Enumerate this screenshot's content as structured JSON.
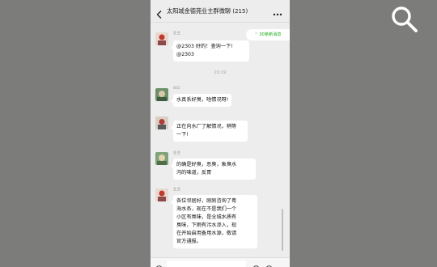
{
  "chat": {
    "title": "太阳城金德苑业主群微聊",
    "member_count": "(215)",
    "unread_notice": "30条新消息",
    "time_separator": "20:19"
  },
  "messages": [
    {
      "sender": "业主",
      "lines": [
        "@2303 好的！查询一下!",
        "@2303"
      ]
    },
    {
      "sender": "802",
      "lines": [
        "水真系好臭，啥情况呀!"
      ]
    },
    {
      "sender": "",
      "lines": [
        "正在向水厂了解情况，稍等",
        "一下!"
      ]
    },
    {
      "sender": "业主",
      "lines": [
        "的确是好臭，恶臭，象臭水",
        "沟的味道，反胃"
      ]
    },
    {
      "sender": "业主",
      "lines": [
        "各位邻居好，刚刚咨询了粤",
        "海水务，现在不是我们一个",
        "小区有臭味，是全城水质有",
        "臭味，下雨有污水渗入，现",
        "在开始启用备用水源，敬请",
        "官方通报。"
      ]
    }
  ],
  "icons": {
    "search": "search-icon",
    "back": "back-arrow-icon",
    "more": "more-icon",
    "voice": "voice-icon",
    "emoji": "emoji-icon",
    "plus": "plus-icon"
  },
  "colors": {
    "accent": "#1aad19",
    "chat_bg": "#ededed",
    "bubble": "#ffffff",
    "outer_bg": "#7c7c7a"
  }
}
